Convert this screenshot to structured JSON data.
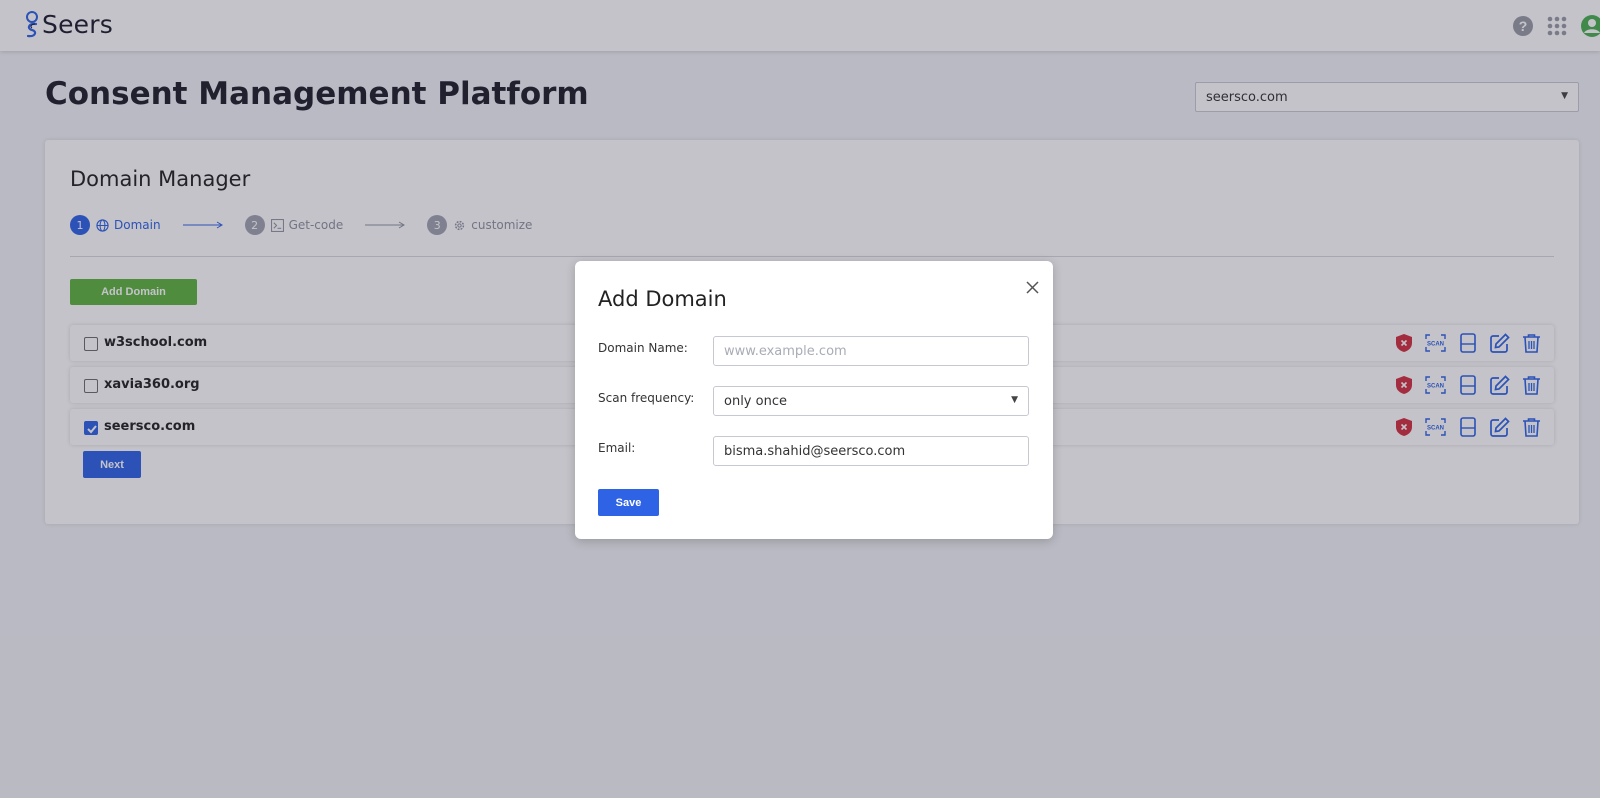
{
  "brand": {
    "name": "Seers"
  },
  "page": {
    "title": "Consent Management Platform"
  },
  "domain_selector": {
    "value": "seersco.com"
  },
  "card": {
    "title": "Domain Manager"
  },
  "stepper": [
    {
      "number": "1",
      "label": "Domain",
      "icon": "globe-icon",
      "state": "active"
    },
    {
      "number": "2",
      "label": "Get-code",
      "icon": "terminal-icon",
      "state": "inactive"
    },
    {
      "number": "3",
      "label": "customize",
      "icon": "gear-icon",
      "state": "inactive"
    }
  ],
  "add_domain_button": "Add Domain",
  "domains": [
    {
      "name": "w3school.com",
      "checked": false
    },
    {
      "name": "xavia360.org",
      "checked": false
    },
    {
      "name": "seersco.com",
      "checked": true
    }
  ],
  "row_actions": [
    "shield-x-icon",
    "scan-icon",
    "document-icon",
    "edit-icon",
    "trash-icon"
  ],
  "next_button": "Next",
  "modal": {
    "title": "Add Domain",
    "domain_name_label": "Domain Name:",
    "domain_name_placeholder": "www.example.com",
    "domain_name_value": "",
    "scan_frequency_label": "Scan frequency:",
    "scan_frequency_value": "only once",
    "email_label": "Email:",
    "email_value": "bisma.shahid@seersco.com",
    "save_label": "Save"
  },
  "colors": {
    "primary": "#2f63e6",
    "success": "#5fb33f",
    "danger": "#d32f3f",
    "profile": "#4caf50"
  }
}
